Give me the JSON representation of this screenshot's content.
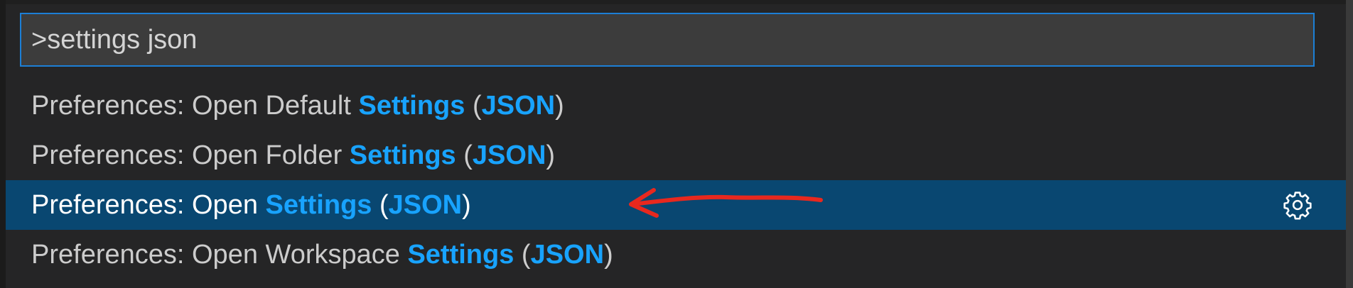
{
  "quick_open": {
    "input_value": ">settings json",
    "items": [
      {
        "prefix": "Preferences: Open Default ",
        "highlight1": "Settings",
        "mid": " (",
        "highlight2": "JSON",
        "suffix": ")",
        "selected": false
      },
      {
        "prefix": "Preferences: Open Folder ",
        "highlight1": "Settings",
        "mid": " (",
        "highlight2": "JSON",
        "suffix": ")",
        "selected": false
      },
      {
        "prefix": "Preferences: Open ",
        "highlight1": "Settings",
        "mid": " (",
        "highlight2": "JSON",
        "suffix": ")",
        "selected": true,
        "action_icon": "gear-icon"
      },
      {
        "prefix": "Preferences: Open Workspace ",
        "highlight1": "Settings",
        "mid": " (",
        "highlight2": "JSON",
        "suffix": ")",
        "selected": false
      }
    ]
  },
  "annotation": {
    "icon": "red-arrow",
    "color": "#e8281e"
  },
  "colors": {
    "background": "#252526",
    "input_background": "#3c3c3c",
    "input_border": "#1c7fd6",
    "selected_row": "#094771",
    "highlight": "#18a3ff",
    "text": "#cccccc"
  }
}
